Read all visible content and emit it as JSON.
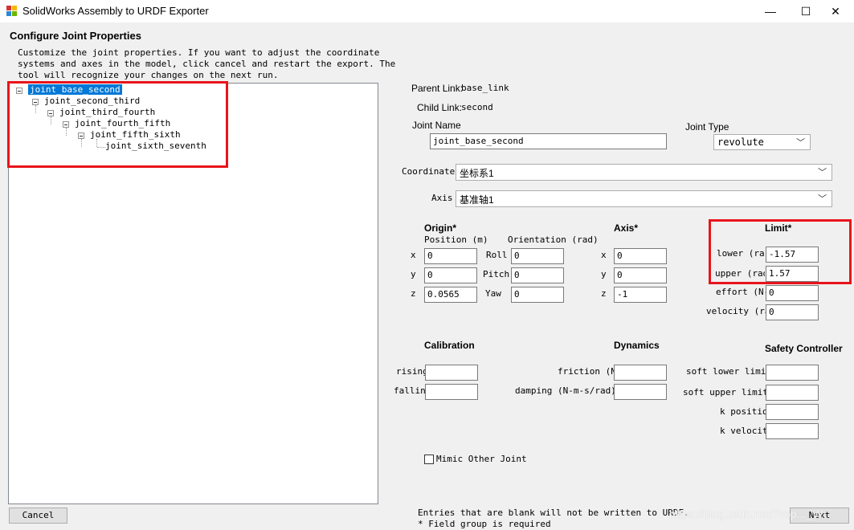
{
  "window": {
    "title": "SolidWorks Assembly to URDF Exporter",
    "minimize": "—",
    "maximize": "☐",
    "close": "✕"
  },
  "header": {
    "title": "Configure Joint Properties",
    "desc1": "Customize the joint properties. If you want to adjust the coordinate",
    "desc2": "systems and axes in the model, click cancel and restart the export. The",
    "desc3": "tool will recognize your changes on the next run."
  },
  "tree": [
    {
      "label": "joint_base_second"
    },
    {
      "label": "joint_second_third"
    },
    {
      "label": "joint_third_fourth"
    },
    {
      "label": "joint_fourth_fifth"
    },
    {
      "label": "joint_fifth_sixth"
    },
    {
      "label": "joint_sixth_seventh"
    }
  ],
  "links": {
    "parent_label": "Parent Link:",
    "parent_value": "base_link",
    "child_label": "Child Link:",
    "child_value": "second"
  },
  "joint": {
    "name_label": "Joint Name",
    "name_value": "joint_base_second",
    "type_label": "Joint Type",
    "type_value": "revolute"
  },
  "coords": {
    "label": "Coordinates",
    "value": "坐标系1"
  },
  "axis_sel": {
    "label": "Axis",
    "value": "基准轴1"
  },
  "origin": {
    "title": "Origin*",
    "pos_label": "Position (m)",
    "ori_label": "Orientation (rad)",
    "x_label": "x",
    "y_label": "y",
    "z_label": "z",
    "x": "0",
    "y": "0",
    "z": "0.0565",
    "roll_label": "Roll",
    "pitch_label": "Pitch",
    "yaw_label": "Yaw",
    "roll": "0",
    "pitch": "0",
    "yaw": "0"
  },
  "axis": {
    "title": "Axis*",
    "x_label": "x",
    "y_label": "y",
    "z_label": "z",
    "x": "0",
    "y": "0",
    "z": "-1"
  },
  "limit": {
    "title": "Limit*",
    "lower_label": "lower (rad",
    "lower": "-1.57",
    "upper_label": "upper (rad",
    "upper": "1.57",
    "effort_label": "effort (N-m",
    "effort": "0",
    "velocity_label": "velocity (ra",
    "velocity": "0"
  },
  "calibration": {
    "title": "Calibration",
    "rising_label": "rising",
    "rising": "",
    "falling_label": "falling",
    "falling": ""
  },
  "dynamics": {
    "title": "Dynamics",
    "friction_label": "friction (N-",
    "friction": "",
    "damping_label": "damping (N-m-s/rad)",
    "damping": ""
  },
  "safety": {
    "title": "Safety Controller",
    "soft_lower_label": "soft lower limit",
    "soft_lower": "",
    "soft_upper_label": "soft upper limit",
    "soft_upper": "",
    "k_position_label": "k position",
    "k_position": "",
    "k_velocity_label": "k velocity",
    "k_velocity": ""
  },
  "mimic": {
    "label": "Mimic Other Joint"
  },
  "footer": {
    "note1": "Entries that are blank will not be written to URDF.",
    "note2": "* Field group is required",
    "cancel": "Cancel",
    "next": "Next",
    "watermark": "https://blog.csdn.net/Prop..._W"
  },
  "colors": {
    "accent_selection": "#0078d7",
    "annotation": "#e8141b"
  }
}
